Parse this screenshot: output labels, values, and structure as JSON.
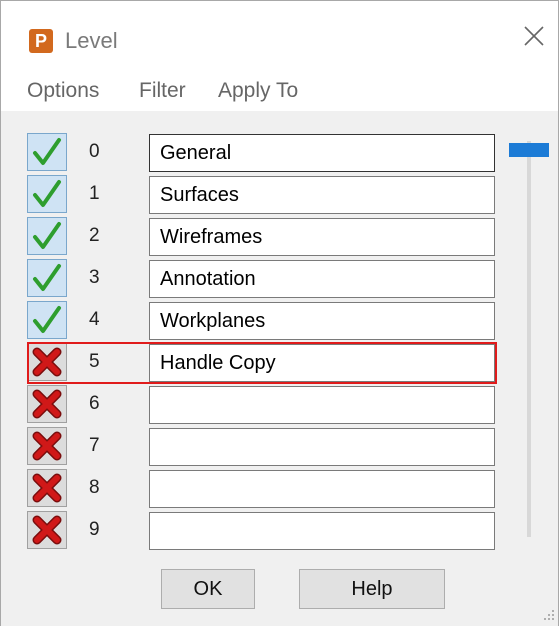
{
  "window": {
    "title": "Level",
    "app_icon_letter": "P"
  },
  "menu": [
    "Options",
    "Filter",
    "Apply To"
  ],
  "levels": [
    {
      "number": "0",
      "name": "General",
      "enabled": true
    },
    {
      "number": "1",
      "name": "Surfaces",
      "enabled": true
    },
    {
      "number": "2",
      "name": "Wireframes",
      "enabled": true
    },
    {
      "number": "3",
      "name": "Annotation",
      "enabled": true
    },
    {
      "number": "4",
      "name": "Workplanes",
      "enabled": true
    },
    {
      "number": "5",
      "name": "Handle Copy",
      "enabled": false,
      "highlighted": true
    },
    {
      "number": "6",
      "name": "",
      "enabled": false
    },
    {
      "number": "7",
      "name": "",
      "enabled": false
    },
    {
      "number": "8",
      "name": "",
      "enabled": false
    },
    {
      "number": "9",
      "name": "",
      "enabled": false
    }
  ],
  "buttons": {
    "ok": "OK",
    "help": "Help"
  },
  "scroll": {
    "position_fraction": 0.0
  },
  "colors": {
    "check_on": "#2e9e2e",
    "check_off": "#d01818",
    "highlight": "#e01b1b",
    "scroll_thumb": "#1c7bd6",
    "app_icon": "#d2691e"
  },
  "icons": {
    "enabled": "green-checkmark-icon",
    "disabled": "red-x-icon",
    "close": "close-icon"
  }
}
